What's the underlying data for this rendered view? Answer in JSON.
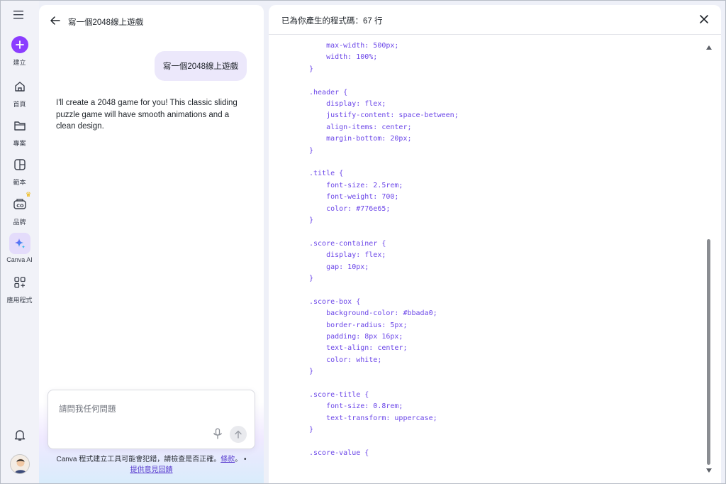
{
  "rail": {
    "items": [
      {
        "label": "建立",
        "icon": "plus-icon"
      },
      {
        "label": "首頁",
        "icon": "home-icon"
      },
      {
        "label": "專案",
        "icon": "folder-icon"
      },
      {
        "label": "範本",
        "icon": "template-icon"
      },
      {
        "label": "品牌",
        "icon": "brand-icon"
      },
      {
        "label": "Canva AI",
        "icon": "sparkle-icon"
      },
      {
        "label": "應用程式",
        "icon": "apps-icon"
      }
    ],
    "accent": "#8b3dff"
  },
  "chat": {
    "title": "寫一個2048線上遊戲",
    "user_message": "寫一個2048線上遊戲",
    "ai_message": "I'll create a 2048 game for you! This classic sliding puzzle game will have smooth animations and a clean design.",
    "input_placeholder": "請問我任何問題",
    "disclaimer_text": "Canva 程式建立工具可能會犯錯，請檢查是否正確。",
    "disclaimer_link_terms": "條款",
    "disclaimer_dot": "。 •",
    "disclaimer_link_feedback": "提供意見回饋"
  },
  "code": {
    "title": "已為你產生的程式碼：67 行",
    "lines": [
      "    max-width: 500px;",
      "    width: 100%;",
      "}",
      "",
      ".header {",
      "    display: flex;",
      "    justify-content: space-between;",
      "    align-items: center;",
      "    margin-bottom: 20px;",
      "}",
      "",
      ".title {",
      "    font-size: 2.5rem;",
      "    font-weight: 700;",
      "    color: #776e65;",
      "}",
      "",
      ".score-container {",
      "    display: flex;",
      "    gap: 10px;",
      "}",
      "",
      ".score-box {",
      "    background-color: #bbada0;",
      "    border-radius: 5px;",
      "    padding: 8px 16px;",
      "    text-align: center;",
      "    color: white;",
      "}",
      "",
      ".score-title {",
      "    font-size: 0.8rem;",
      "    text-transform: uppercase;",
      "}",
      "",
      ".score-value {"
    ],
    "code_color": "#6b46e8"
  }
}
